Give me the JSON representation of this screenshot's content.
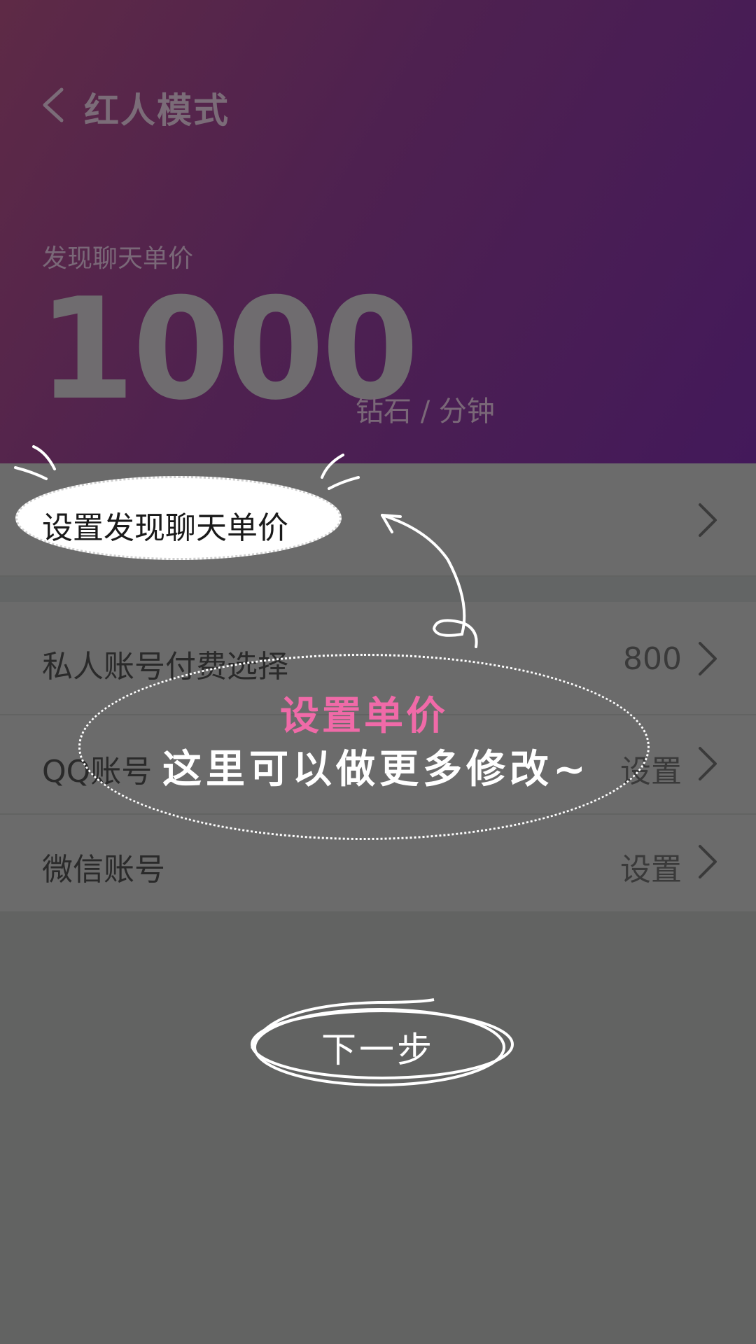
{
  "nav": {
    "title": "红人模式",
    "back_icon": "chevron-left-icon"
  },
  "price": {
    "label": "发现聊天单价",
    "value": "1000",
    "unit": "钻石 / 分钟"
  },
  "rows": [
    {
      "label": "设置发现聊天单价",
      "value": ""
    },
    {
      "label": "私人账号付费选择",
      "value": "800"
    },
    {
      "label": "QQ账号",
      "value": "设置"
    },
    {
      "label": "微信账号",
      "value": "设置"
    }
  ],
  "tip": {
    "title": "设置单价",
    "text": "这里可以做更多修改~"
  },
  "next_button": {
    "label": "下一步"
  },
  "colors": {
    "header_start": "#5e2a46",
    "header_end": "#43195a",
    "overlay": "#626362",
    "tip_pink": "#f06aa8"
  }
}
